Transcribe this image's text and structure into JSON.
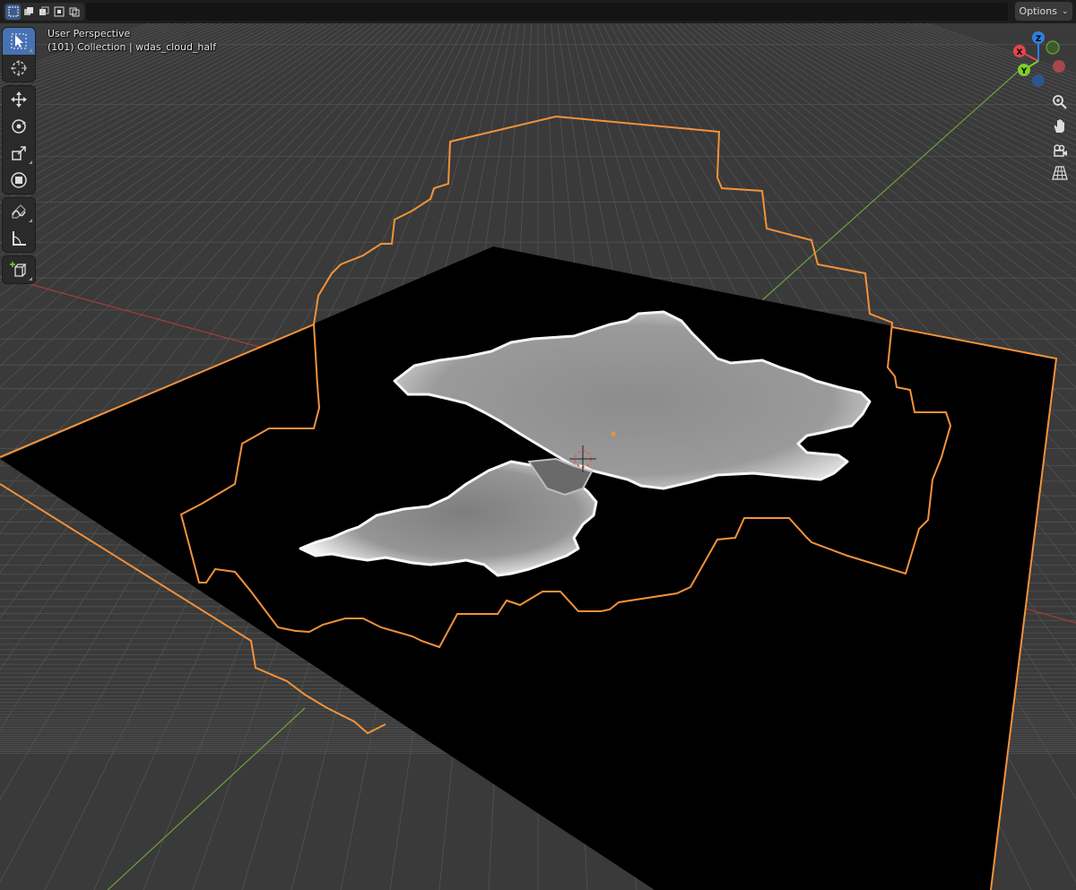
{
  "header": {
    "options_label": "Options",
    "select_modes": [
      "select-box-new",
      "select-box-extend",
      "select-box-subtract",
      "select-box-invert",
      "select-box-intersect"
    ]
  },
  "viewport": {
    "view_name": "User Perspective",
    "collection_info": "(101) Collection | wdas_cloud_half",
    "background_color": "#3a3a3a",
    "selection_outline_color": "#f2923a",
    "x_axis_color": "#a83a3a",
    "y_axis_color": "#6aa23a"
  },
  "toolbar": {
    "groups": [
      [
        "select-box-tool",
        "cursor-tool"
      ],
      [
        "move-tool",
        "rotate-tool",
        "scale-tool",
        "transform-tool"
      ],
      [
        "annotate-tool",
        "measure-tool"
      ],
      [
        "add-cube-tool"
      ]
    ],
    "active": "select-box-tool"
  },
  "gizmo": {
    "axes": [
      {
        "label": "Z",
        "color": "#2f7fe0"
      },
      {
        "label": "X",
        "color": "#e0454f"
      },
      {
        "label": "Y",
        "color": "#7ccf2b"
      }
    ],
    "negative_axis_colors": [
      "#6aa23a",
      "#c24a4f",
      "#2a5aa0"
    ]
  },
  "nav_buttons": [
    "zoom-icon",
    "pan-hand-icon",
    "camera-view-icon",
    "ortho-grid-icon"
  ]
}
